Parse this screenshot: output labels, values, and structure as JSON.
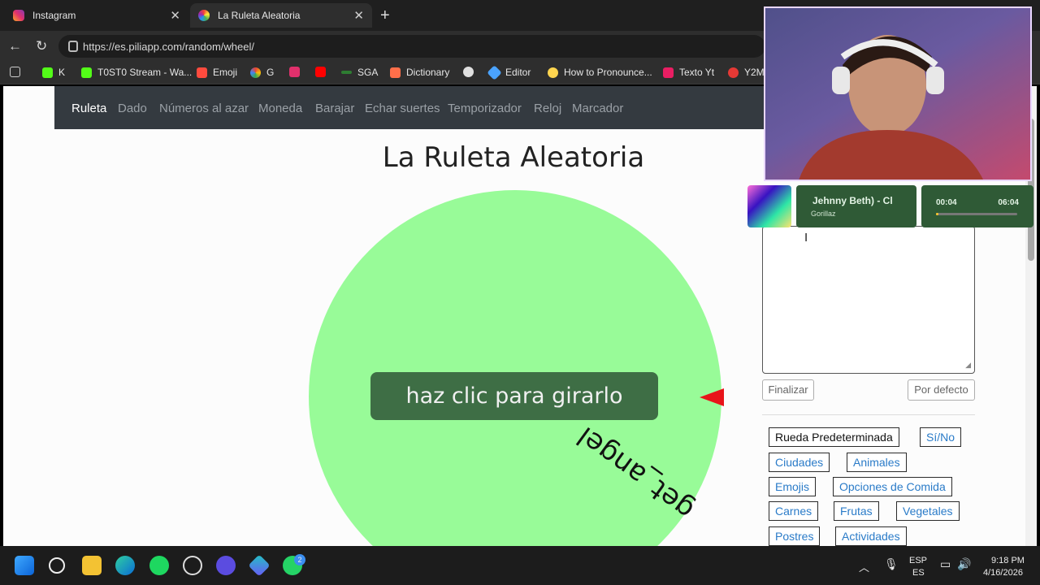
{
  "browser": {
    "tabs": [
      {
        "title": "Instagram",
        "icon": "instagram-icon",
        "active": false
      },
      {
        "title": "La Ruleta Aleatoria",
        "icon": "piliapp-icon",
        "active": true
      }
    ],
    "url": "https://es.piliapp.com/random/wheel/",
    "bookmarks": [
      {
        "label": "K",
        "icon": "kick-icon",
        "color": "#53fc18"
      },
      {
        "label": "T0ST0 Stream - Wa...",
        "icon": "kick-icon",
        "color": "#53fc18"
      },
      {
        "label": "Emoji",
        "icon": "lightning-icon",
        "color": "#ff4b3e"
      },
      {
        "label": "G",
        "icon": "google-icon",
        "color": "#4285f4"
      },
      {
        "label": "",
        "icon": "instagram-icon",
        "color": "#e1306c"
      },
      {
        "label": "",
        "icon": "youtube-icon",
        "color": "#ff0000"
      },
      {
        "label": "SGA",
        "icon": "sga-icon",
        "color": "#2e7d32"
      },
      {
        "label": "Dictionary",
        "icon": "dictionary-icon",
        "color": "#ff6f4a"
      },
      {
        "label": "",
        "icon": "openai-icon",
        "color": "#e0e0e0"
      },
      {
        "label": "Editor",
        "icon": "editor-icon",
        "color": "#4aa3ff"
      },
      {
        "label": "How to Pronounce...",
        "icon": "pronounce-icon",
        "color": "#ffd54f"
      },
      {
        "label": "Texto Yt",
        "icon": "texto-icon",
        "color": "#e91e63"
      },
      {
        "label": "Y2M",
        "icon": "y2mate-icon",
        "color": "#e53935"
      }
    ]
  },
  "site": {
    "nav": [
      "Ruleta",
      "Dado",
      "Números al azar",
      "Moneda",
      "Barajar",
      "Echar suertes",
      "Temporizador",
      "Reloj",
      "Marcador"
    ],
    "active_nav": "Ruleta",
    "title": "La Ruleta Aleatoria"
  },
  "wheel": {
    "segment_label": "get_angel",
    "spin_button": "haz clic para girarlo",
    "color": "#98fb98"
  },
  "controls": {
    "finalizar": "Finalizar",
    "por_defecto": "Por defecto"
  },
  "presets": [
    "Rueda Predeterminada",
    "Sí/No",
    "Ciudades",
    "Animales",
    "Emojis",
    "Opciones de Comida",
    "Carnes",
    "Frutas",
    "Vegetales",
    "Postres",
    "Actividades"
  ],
  "music": {
    "title": "Jehnny Beth) - Cl",
    "artist": "Gorillaz",
    "elapsed": "00:04",
    "total": "06:04",
    "progress": 0.011
  },
  "taskbar": {
    "lang": "ESP",
    "lang2": "ES",
    "time": "9:18 PM",
    "date": "4/16/2026",
    "whatsapp_badge": "2"
  }
}
